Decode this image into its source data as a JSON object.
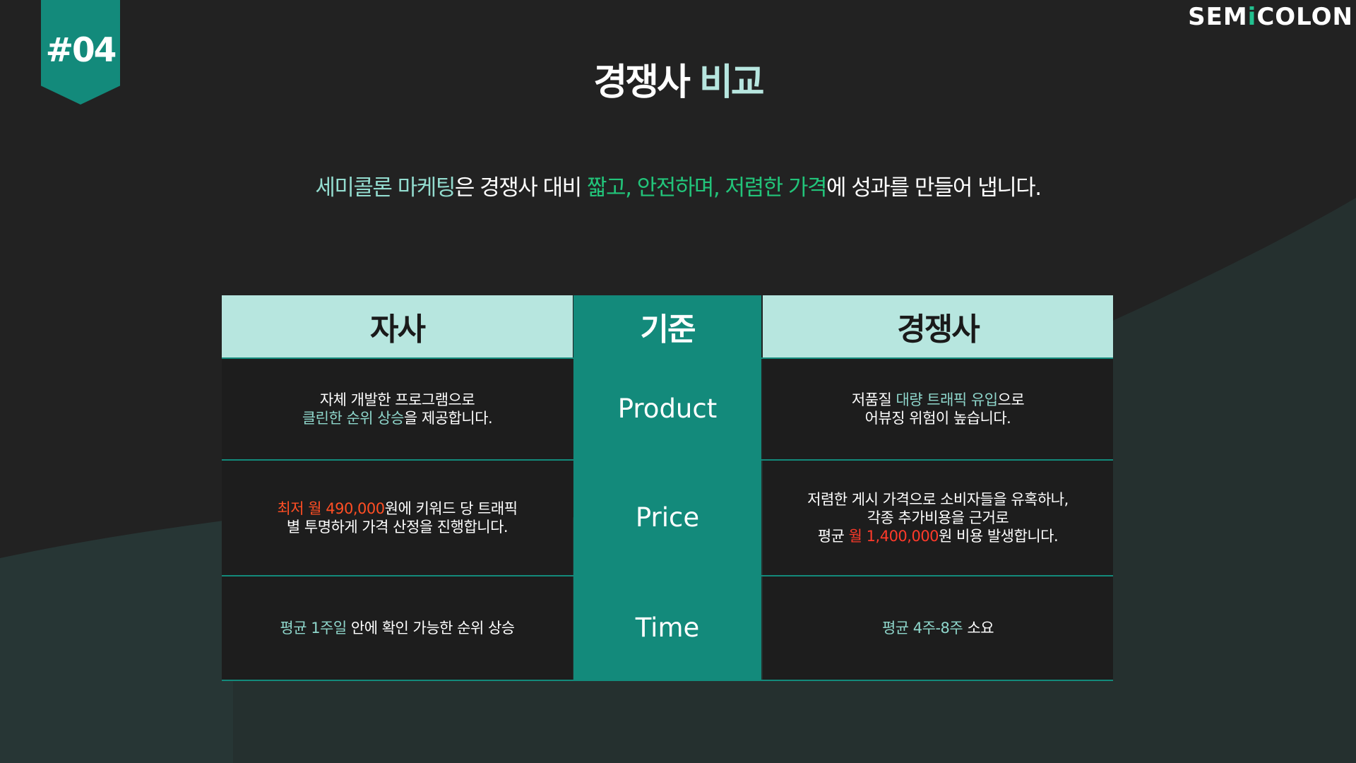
{
  "badge": {
    "label": "#04"
  },
  "brand": {
    "part1": "SEM",
    "part2": "i",
    "part3": "COLON"
  },
  "title": {
    "part1": "경쟁사",
    "part2": "비교"
  },
  "subtitle": {
    "p1": "세미콜론 마케팅",
    "p2": "은 경쟁사 대비 ",
    "p3": "짧고, 안전하며, 저렴한 가격",
    "p4": "에 성과를 만들어 냅니다."
  },
  "table": {
    "headers": {
      "left": "자사",
      "mid": "기준",
      "right": "경쟁사"
    },
    "rows": [
      {
        "criterion": "Product",
        "left": {
          "l1": "자체 개발한 프로그램으로",
          "l2a": "클린한 순위 상승",
          "l2b": "을 제공합니다."
        },
        "right": {
          "l1a": "저품질 ",
          "l1b": "대량 트래픽 유입",
          "l1c": "으로",
          "l2": "어뷰징 위험이 높습니다."
        }
      },
      {
        "criterion": "Price",
        "left": {
          "l1a": "최저 월 490,000",
          "l1b": "원에 키워드 당 트래픽",
          "l2": "별 투명하게 가격 산정을 진행합니다."
        },
        "right": {
          "l1": "저렴한 게시 가격으로 소비자들을 유혹하나,",
          "l2": "각종 추가비용을 근거로",
          "l3a": "평균 ",
          "l3b": "월 1,400,000",
          "l3c": "원 비용 발생합니다."
        }
      },
      {
        "criterion": "Time",
        "left": {
          "l1a": "평균 1주일",
          "l1b": " 안에 확인 가능한 순위 상승"
        },
        "right": {
          "l1a": "평균 4주-8주",
          "l1b": " 소요"
        }
      }
    ]
  },
  "colors": {
    "background": "#222222",
    "accent_teal": "#138a7b",
    "mint": "#b7e6df",
    "green": "#22c47a",
    "red": "#ff3a2a"
  }
}
